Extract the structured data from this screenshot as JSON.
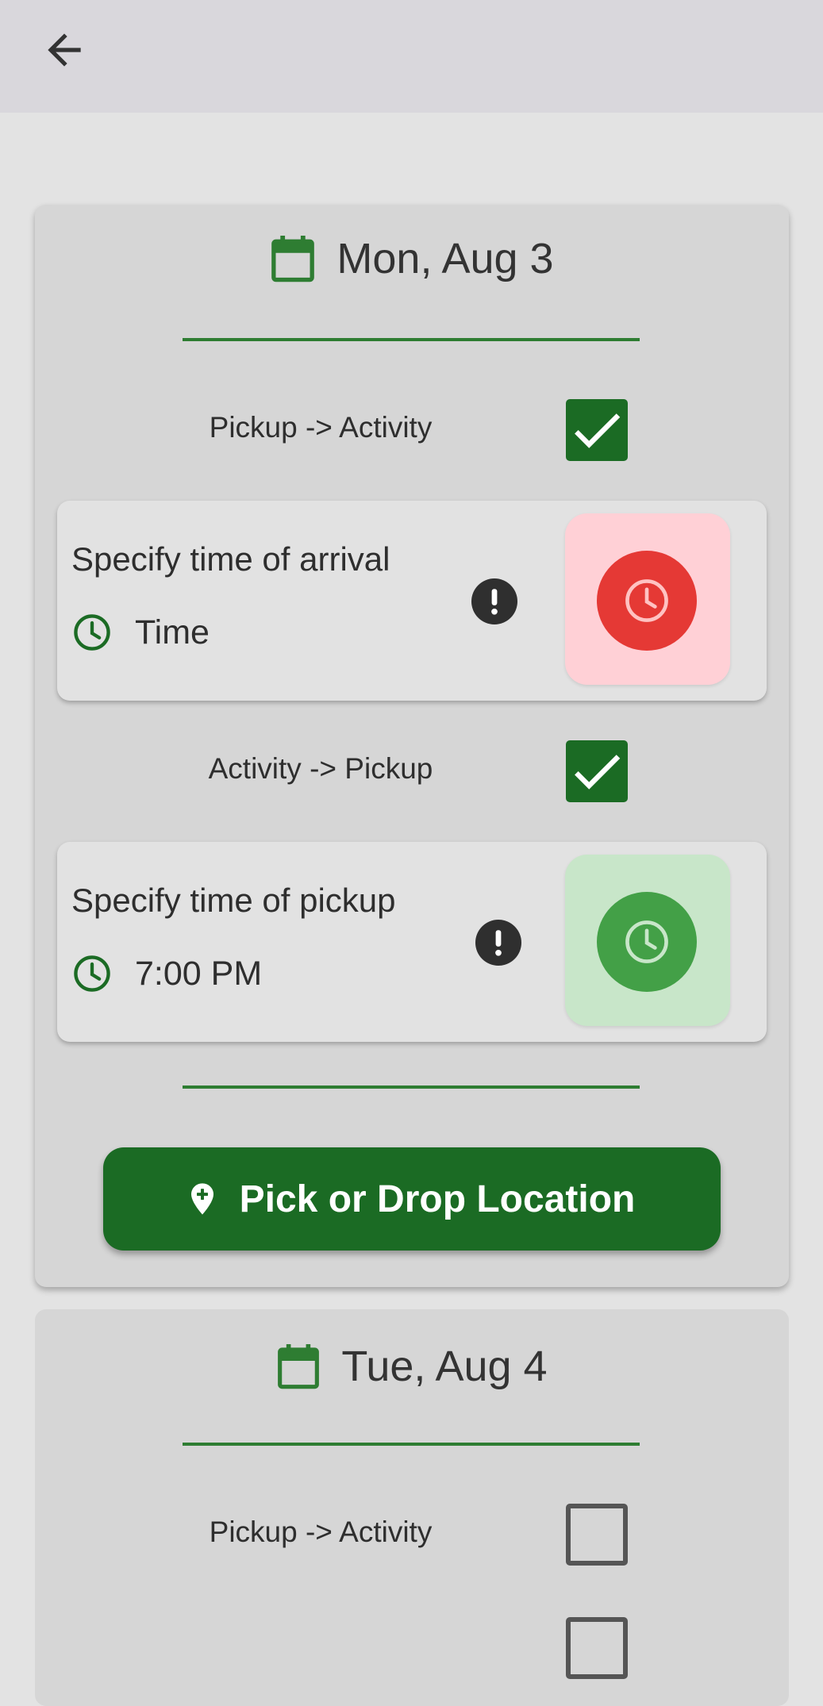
{
  "app_bar": {
    "back_icon": "arrow-left-icon"
  },
  "colors": {
    "primary_green": "#1b6b24",
    "accent_green": "#2e7d32",
    "missing_red": "#e53935",
    "missing_red_bg": "#ffd0d6",
    "set_green": "#43a047",
    "set_green_bg": "#c8e6c9"
  },
  "days": [
    {
      "date": "Mon, Aug 3",
      "calendar_icon": "calendar-icon",
      "legs": [
        {
          "label": "Pickup -> Activity",
          "checked": true,
          "time_card": {
            "title": "Specify time of arrival",
            "value": "Time",
            "status": "missing",
            "clock_icon": "clock-icon",
            "info_icon": "exclamation-icon"
          }
        },
        {
          "label": "Activity -> Pickup",
          "checked": true,
          "time_card": {
            "title": "Specify time of pickup",
            "value": "7:00 PM",
            "status": "set",
            "clock_icon": "clock-icon",
            "info_icon": "exclamation-icon"
          }
        }
      ],
      "location_button": {
        "label": "Pick or Drop Location",
        "icon": "location-add-icon"
      }
    },
    {
      "date": "Tue, Aug 4",
      "calendar_icon": "calendar-icon",
      "legs": [
        {
          "label": "Pickup -> Activity",
          "checked": false
        }
      ]
    }
  ]
}
